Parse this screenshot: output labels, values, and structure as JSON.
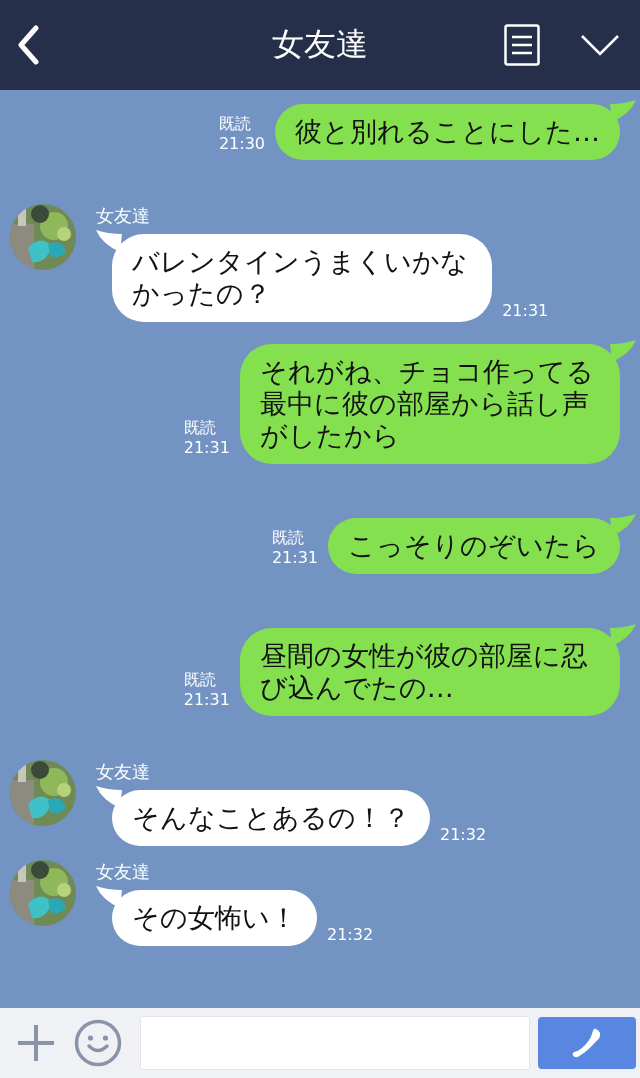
{
  "header": {
    "title": "女友達"
  },
  "messages": [
    {
      "kind": "sent",
      "read": "既読",
      "time": "21:30",
      "text": "彼と別れることにした…"
    },
    {
      "kind": "received",
      "name": "女友達",
      "time": "21:31",
      "text": "バレンタインうまくいかなかったの？"
    },
    {
      "kind": "sent",
      "read": "既読",
      "time": "21:31",
      "text": "それがね、チョコ作ってる最中に彼の部屋から話し声がしたから"
    },
    {
      "kind": "sent",
      "read": "既読",
      "time": "21:31",
      "text": "こっそりのぞいたら"
    },
    {
      "kind": "sent",
      "read": "既読",
      "time": "21:31",
      "text": "昼間の女性が彼の部屋に忍び込んでたの…"
    },
    {
      "kind": "received",
      "name": "女友達",
      "time": "21:32",
      "text": "そんなことあるの！？"
    },
    {
      "kind": "received",
      "name": "女友達",
      "time": "21:32",
      "text": "その女怖い！"
    }
  ]
}
